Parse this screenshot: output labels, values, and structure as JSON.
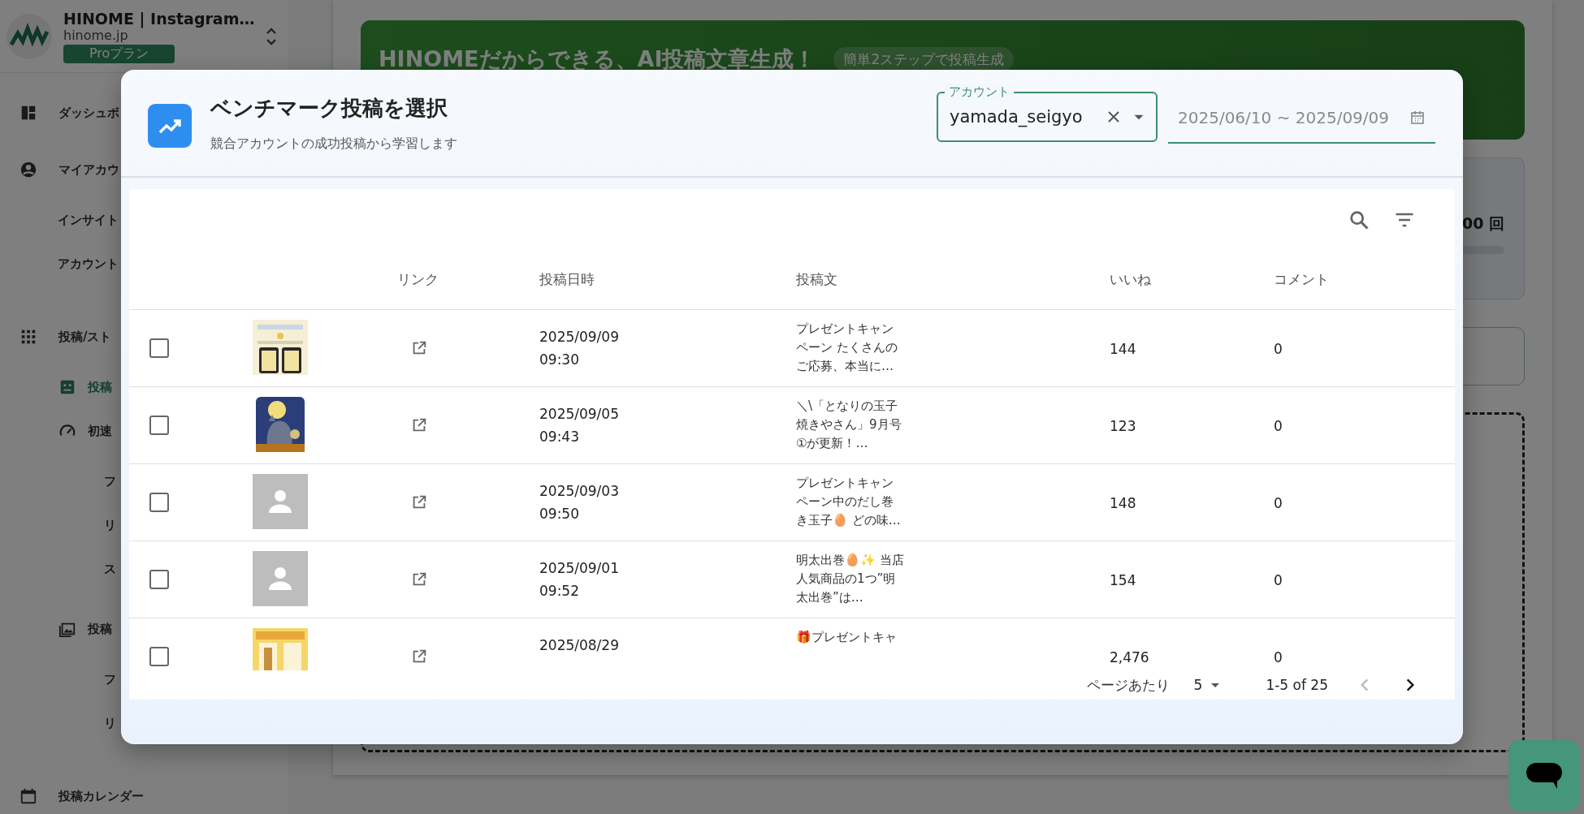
{
  "sidebar": {
    "app_name": "HINOME | Instagram…",
    "domain": "hinome.jp",
    "plan": "Proプラン",
    "items": [
      {
        "label": "ダッシュボ",
        "kind": "icon",
        "selected": false
      },
      {
        "label": "マイアカウ",
        "kind": "icon",
        "selected": false,
        "children": [
          {
            "label": "インサイト",
            "kind": "plain",
            "selected": false
          },
          {
            "label": "アカウント",
            "kind": "plain",
            "selected": false
          }
        ]
      },
      {
        "label": "投稿/スト",
        "kind": "icon",
        "selected": false,
        "children": [
          {
            "label": "投稿",
            "kind": "icon",
            "selected": true
          },
          {
            "label": "初速",
            "kind": "icon",
            "selected": false,
            "children": [
              {
                "label": "フ",
                "kind": "plain",
                "selected": false
              },
              {
                "label": "リ",
                "kind": "plain",
                "selected": false
              },
              {
                "label": "ス",
                "kind": "plain",
                "selected": false
              }
            ]
          },
          {
            "label": "投稿",
            "kind": "icon",
            "selected": false,
            "children": [
              {
                "label": "フ",
                "kind": "plain",
                "selected": false
              },
              {
                "label": "リ",
                "kind": "plain",
                "selected": false
              }
            ]
          }
        ]
      },
      {
        "label": "投稿カレンダー",
        "kind": "icon",
        "selected": false
      }
    ]
  },
  "background": {
    "banner_title": "HINOMEだからできる、AI投稿文章生成！",
    "banner_chip": "簡単2ステップで投稿生成",
    "stat_value": "00 回"
  },
  "modal": {
    "title": "ベンチマーク投稿を選択",
    "subtitle": "競合アカウントの成功投稿から学習します",
    "account_field": {
      "label": "アカウント",
      "value": "yamada_seigyo"
    },
    "date_field": {
      "value": "2025/06/10 ~ 2025/09/09"
    },
    "table": {
      "columns": [
        "リンク",
        "投稿日時",
        "投稿文",
        "いいね",
        "コメント"
      ],
      "rows": [
        {
          "checked": false,
          "posted": "2025/09/09\n09:30",
          "text": "プレゼントキャンペーン たくさんのご応募、本当に…",
          "likes": "144",
          "comments": "0"
        },
        {
          "checked": false,
          "posted": "2025/09/05\n09:43",
          "text": "＼\\「となりの玉子焼きやさん」9月号①が更新！…",
          "likes": "123",
          "comments": "0"
        },
        {
          "checked": false,
          "thumbnail": {
            "kind": "placeholder"
          },
          "posted": "2025/09/03\n09:50",
          "text": "プレゼントキャンペーン中のだし巻き玉子🥚 どの味…",
          "likes": "148",
          "comments": "0"
        },
        {
          "checked": false,
          "thumbnail": {
            "kind": "placeholder"
          },
          "posted": "2025/09/01\n09:52",
          "text": "明太出巻🥚✨ 当店人気商品の1つ”明太出巻”は…",
          "likes": "154",
          "comments": "0"
        },
        {
          "checked": false,
          "posted": "2025/08/29",
          "text": "🎁プレゼントキャ",
          "likes": "2,476",
          "comments": "0"
        }
      ]
    },
    "pagination": {
      "per_page_label": "ページあたり",
      "per_page": "5",
      "range": "1-5 of 25",
      "prev": {
        "disabled": true
      },
      "next": {
        "disabled": false
      }
    }
  }
}
